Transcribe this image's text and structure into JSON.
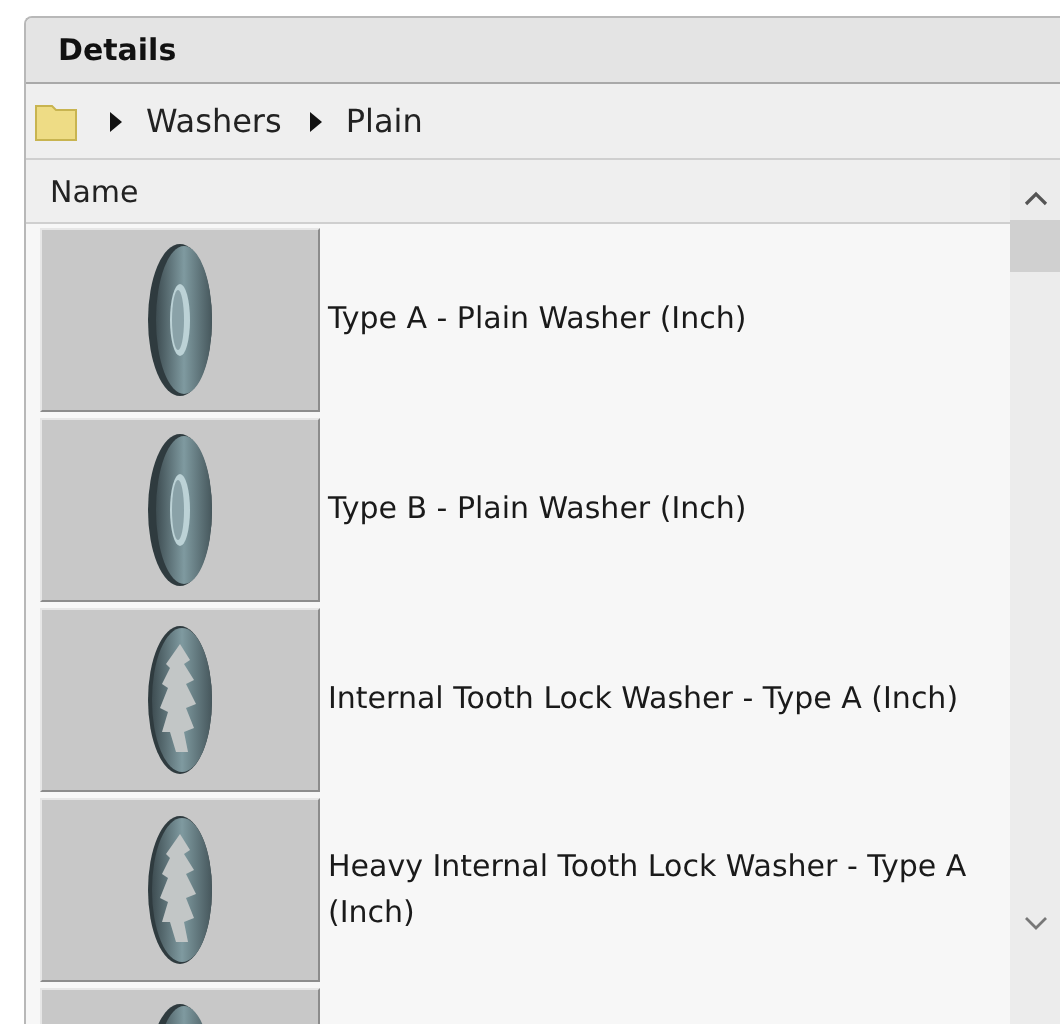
{
  "panel": {
    "title": "Details"
  },
  "breadcrumb": [
    "Washers",
    "Plain"
  ],
  "list": {
    "column": "Name",
    "items": [
      {
        "kind": "plain",
        "name": "Type A - Plain Washer (Inch)"
      },
      {
        "kind": "plain",
        "name": "Type B - Plain Washer (Inch)"
      },
      {
        "kind": "tooth",
        "name": "Internal Tooth Lock Washer - Type A (Inch)"
      },
      {
        "kind": "tooth",
        "name": "Heavy Internal Tooth Lock Washer - Type A (Inch)"
      },
      {
        "kind": "plain"
      }
    ]
  }
}
